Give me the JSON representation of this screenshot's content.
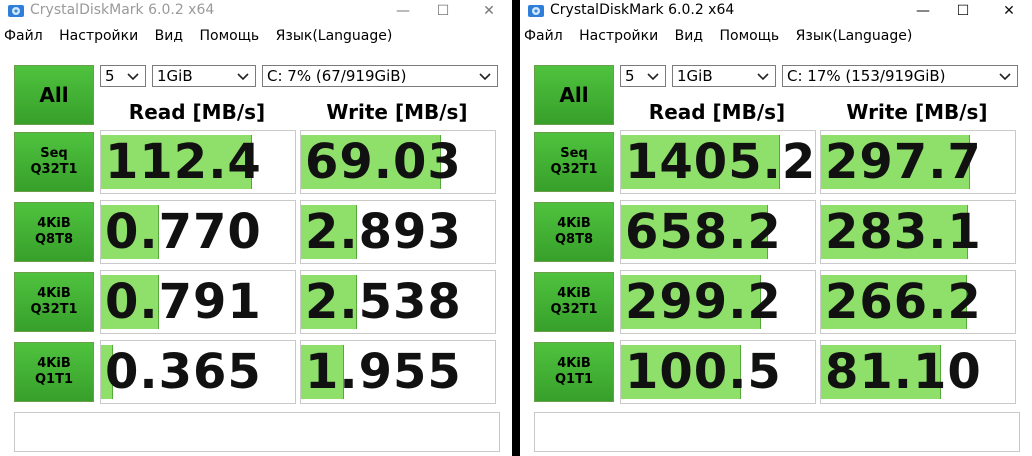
{
  "windows": [
    {
      "title": "CrystalDiskMark 6.0.2 x64",
      "window_buttons": {
        "minimize": "—",
        "maximize": "☐",
        "close": "✕"
      },
      "menu": [
        "Файл",
        "Настройки",
        "Вид",
        "Помощь",
        "Язык(Language)"
      ],
      "all_label": "All",
      "count": "5",
      "size": "1GiB",
      "drive": "C: 7% (67/919GiB)",
      "read_header": "Read [MB/s]",
      "write_header": "Write [MB/s]",
      "rows": [
        {
          "line1": "Seq",
          "line2": "Q32T1",
          "read": "112.4",
          "write": "69.03",
          "read_fill": 0.78,
          "write_fill": 0.72
        },
        {
          "line1": "4KiB",
          "line2": "Q8T8",
          "read": "0.770",
          "write": "2.893",
          "read_fill": 0.3,
          "write_fill": 0.29
        },
        {
          "line1": "4KiB",
          "line2": "Q32T1",
          "read": "0.791",
          "write": "2.538",
          "read_fill": 0.3,
          "write_fill": 0.29
        },
        {
          "line1": "4KiB",
          "line2": "Q1T1",
          "read": "0.365",
          "write": "1.955",
          "read_fill": 0.06,
          "write_fill": 0.22
        }
      ]
    },
    {
      "title": "CrystalDiskMark 6.0.2 x64",
      "window_buttons": {
        "minimize": "—",
        "maximize": "☐",
        "close": "✕"
      },
      "menu": [
        "Файл",
        "Настройки",
        "Вид",
        "Помощь",
        "Язык(Language)"
      ],
      "all_label": "All",
      "count": "5",
      "size": "1GiB",
      "drive": "C: 17% (153/919GiB)",
      "read_header": "Read [MB/s]",
      "write_header": "Write [MB/s]",
      "rows": [
        {
          "line1": "Seq",
          "line2": "Q32T1",
          "read": "1405.2",
          "write": "297.7",
          "read_fill": 0.82,
          "write_fill": 0.77
        },
        {
          "line1": "4KiB",
          "line2": "Q8T8",
          "read": "658.2",
          "write": "283.1",
          "read_fill": 0.76,
          "write_fill": 0.76
        },
        {
          "line1": "4KiB",
          "line2": "Q32T1",
          "read": "299.2",
          "write": "266.2",
          "read_fill": 0.72,
          "write_fill": 0.75
        },
        {
          "line1": "4KiB",
          "line2": "Q1T1",
          "read": "100.5",
          "write": "81.10",
          "read_fill": 0.62,
          "write_fill": 0.62
        }
      ]
    }
  ]
}
